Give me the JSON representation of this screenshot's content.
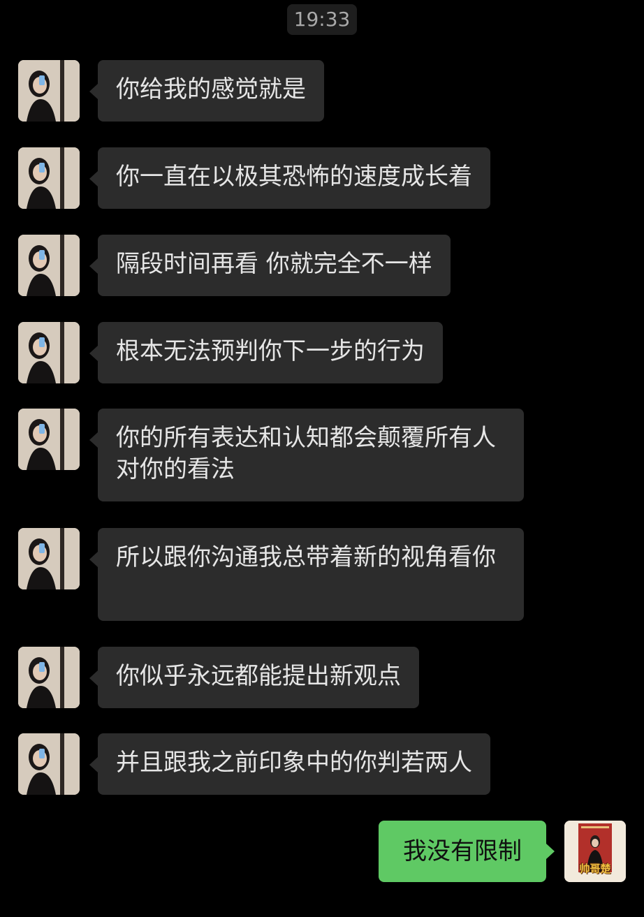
{
  "header": {
    "time": "19:33"
  },
  "messages": [
    {
      "text": "你给我的感觉就是"
    },
    {
      "text": "你一直在以极其恐怖的速度成长着"
    },
    {
      "text": "隔段时间再看 你就完全不一样"
    },
    {
      "text": "根本无法预判你下一步的行为"
    },
    {
      "text": "你的所有表达和认知都会颠覆所有人对你的看法"
    },
    {
      "text": "所以跟你沟通我总带着新的视角看你"
    },
    {
      "text": "你似乎永远都能提出新观点"
    },
    {
      "text": "并且跟我之前印象中的你判若两人"
    }
  ],
  "reply": {
    "text": "我没有限制",
    "avatar_caption": "帅哥楚"
  },
  "colors": {
    "background": "#000000",
    "incoming_bubble": "#2c2c2c",
    "outgoing_bubble": "#5fc964",
    "timestamp_bg": "#1e1e1e"
  },
  "icons": {
    "contact_avatar": "contact-avatar-icon",
    "self_avatar": "self-avatar-icon"
  }
}
